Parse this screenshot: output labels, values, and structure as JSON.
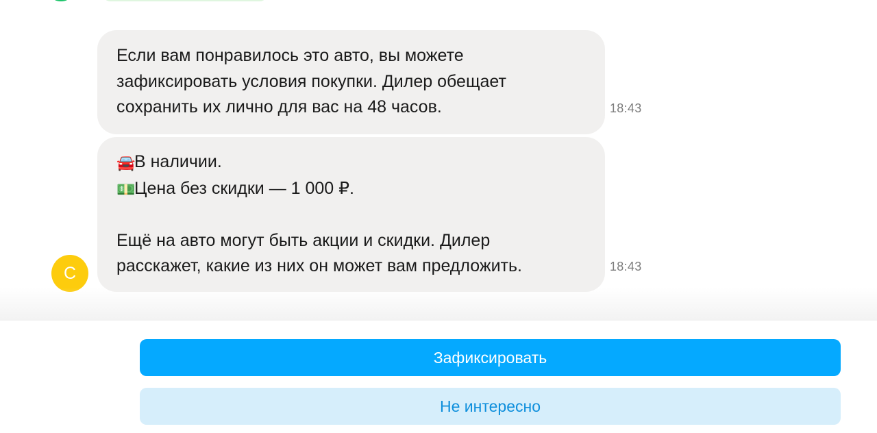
{
  "messages": [
    {
      "text": "Если вам понравилось это авто, вы можете\nзафиксировать условия покупки. Дилер обещает\nсохранить их лично для вас на 48 часов.",
      "time": "18:43"
    },
    {
      "line1_icon": "🚘",
      "line1_text": "В наличии.",
      "line2_icon": "💵",
      "line2_text": "Цена без скидки — 1 000 ₽.",
      "paragraph": "Ещё на авто могут быть акции и скидки. Дилер\nрасскажет, какие из них он может вам предложить.",
      "time": "18:43"
    }
  ],
  "avatar": {
    "letter": "C",
    "color": "#fdcc0d"
  },
  "buttons": {
    "primary_label": "Зафиксировать",
    "secondary_label": "Не интересно"
  },
  "colors": {
    "primary_button": "#05a9ff",
    "secondary_button": "#d6eefb",
    "secondary_text": "#0e8fdc",
    "bubble": "#f1f0ef"
  }
}
